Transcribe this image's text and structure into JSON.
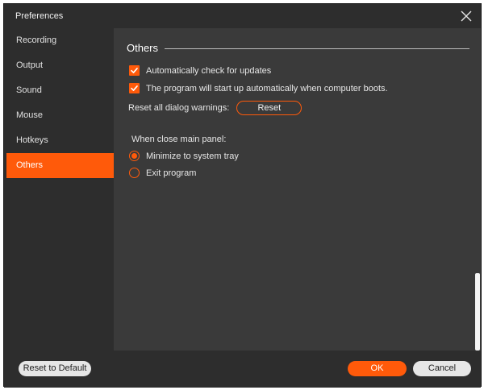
{
  "window": {
    "title": "Preferences"
  },
  "colors": {
    "accent": "#ff5a0a",
    "background": "#2d2d2d",
    "panel": "#3a3a3a"
  },
  "icons": {
    "close": "close-icon",
    "check": "check-icon"
  },
  "sidebar": {
    "items": [
      {
        "label": "Recording",
        "active": false
      },
      {
        "label": "Output",
        "active": false
      },
      {
        "label": "Sound",
        "active": false
      },
      {
        "label": "Mouse",
        "active": false
      },
      {
        "label": "Hotkeys",
        "active": false
      },
      {
        "label": "Others",
        "active": true
      }
    ]
  },
  "others": {
    "section_title": "Others",
    "auto_update": {
      "label": "Automatically check for updates",
      "checked": true
    },
    "auto_start": {
      "label": "The program will start up automatically when computer boots.",
      "checked": true
    },
    "reset_warnings": {
      "label": "Reset all dialog warnings:",
      "button_label": "Reset"
    },
    "close_panel": {
      "label": "When close main panel:",
      "options": [
        {
          "label": "Minimize to system tray",
          "selected": true
        },
        {
          "label": "Exit program",
          "selected": false
        }
      ]
    }
  },
  "footer": {
    "reset_default_label": "Reset to Default",
    "ok_label": "OK",
    "cancel_label": "Cancel"
  }
}
